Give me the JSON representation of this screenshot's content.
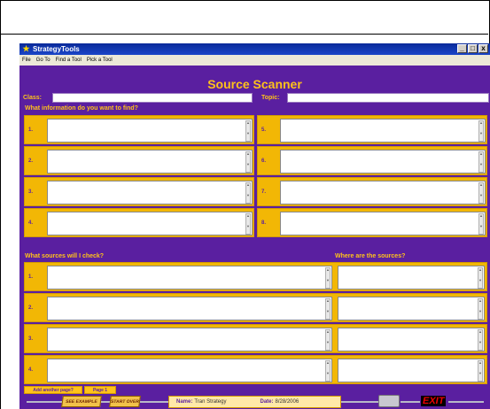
{
  "window": {
    "title": "StrategyTools",
    "menu": [
      "File",
      "Go To",
      "Find a Tool",
      "Pick a Tool"
    ],
    "controls": [
      "_",
      "□",
      "x"
    ]
  },
  "app": {
    "heading": "Source Scanner",
    "class_label": "Class:",
    "class_value": "",
    "topic_label": "Topic:",
    "topic_value": "",
    "q1_label": "What information do you want to find?",
    "info_items": [
      {
        "num": "1.",
        "value": ""
      },
      {
        "num": "2.",
        "value": ""
      },
      {
        "num": "3.",
        "value": ""
      },
      {
        "num": "4.",
        "value": ""
      },
      {
        "num": "5.",
        "value": ""
      },
      {
        "num": "6.",
        "value": ""
      },
      {
        "num": "7.",
        "value": ""
      },
      {
        "num": "8.",
        "value": ""
      }
    ],
    "q2_label": "What sources will I check?",
    "q3_label": "Where are the sources?",
    "source_items": [
      {
        "num": "1.",
        "source": "",
        "where": ""
      },
      {
        "num": "2.",
        "source": "",
        "where": ""
      },
      {
        "num": "3.",
        "source": "",
        "where": ""
      },
      {
        "num": "4.",
        "source": "",
        "where": ""
      }
    ]
  },
  "footer": {
    "add_page": "Add another page?",
    "page_tab": "Page 1",
    "see_example": "SEE EXAMPLE",
    "start_over": "START OVER",
    "name_label": "Name:",
    "name_value": "Tran Strategy",
    "date_label": "Date:",
    "date_value": "8/28/2006",
    "exit": "EXIT"
  },
  "icons": [
    "app-icon",
    "printer-icon",
    "exit-icon"
  ],
  "colors": {
    "bg": "#5a1fa0",
    "accent": "#ffc21a",
    "box": "#f2b705"
  }
}
